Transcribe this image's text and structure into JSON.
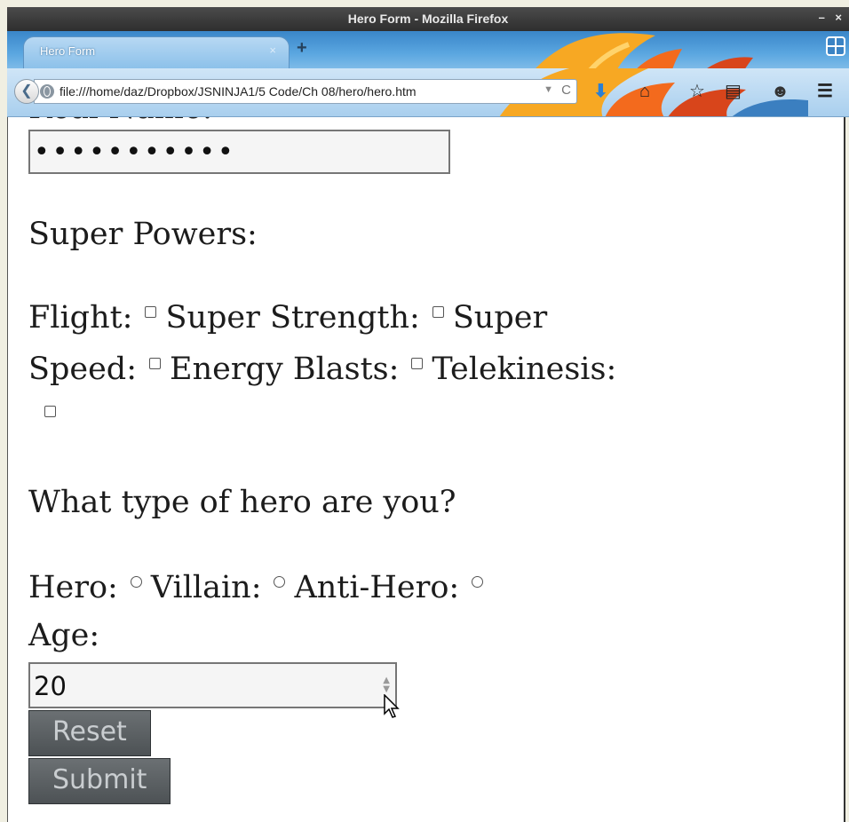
{
  "window": {
    "title": "Hero Form - Mozilla Firefox",
    "controls": "– ×"
  },
  "tabs": [
    {
      "label": "Hero Form",
      "close": "×"
    }
  ],
  "new_tab": "+",
  "address_bar": {
    "url": "file:///home/daz/Dropbox/JSNINJA1/5 Code/Ch 08/hero/hero.htm",
    "dropdown": "▼",
    "reload": "C"
  },
  "nav_icons": {
    "back": "❮",
    "download": "⬇",
    "home": "⌂",
    "bookmark": "☆",
    "reader": "▤",
    "persona": "☻",
    "menu": "☰"
  },
  "form": {
    "clipped_label": "Real Name:",
    "password_value": "•••••••••••",
    "super_powers_heading": "Super Powers:",
    "powers": [
      {
        "label": "Flight:",
        "checked": false
      },
      {
        "label": "Super Strength:",
        "checked": false
      },
      {
        "label": "Super Speed:",
        "checked": false
      },
      {
        "label": "Energy Blasts:",
        "checked": false
      },
      {
        "label": "Telekinesis:",
        "checked": false
      }
    ],
    "hero_type_heading": "What type of hero are you?",
    "hero_types": [
      {
        "label": "Hero:",
        "checked": false
      },
      {
        "label": "Villain:",
        "checked": false
      },
      {
        "label": "Anti-Hero:",
        "checked": false
      }
    ],
    "age_label": "Age:",
    "age_value": "20",
    "reset_label": "Reset",
    "submit_label": "Submit"
  }
}
